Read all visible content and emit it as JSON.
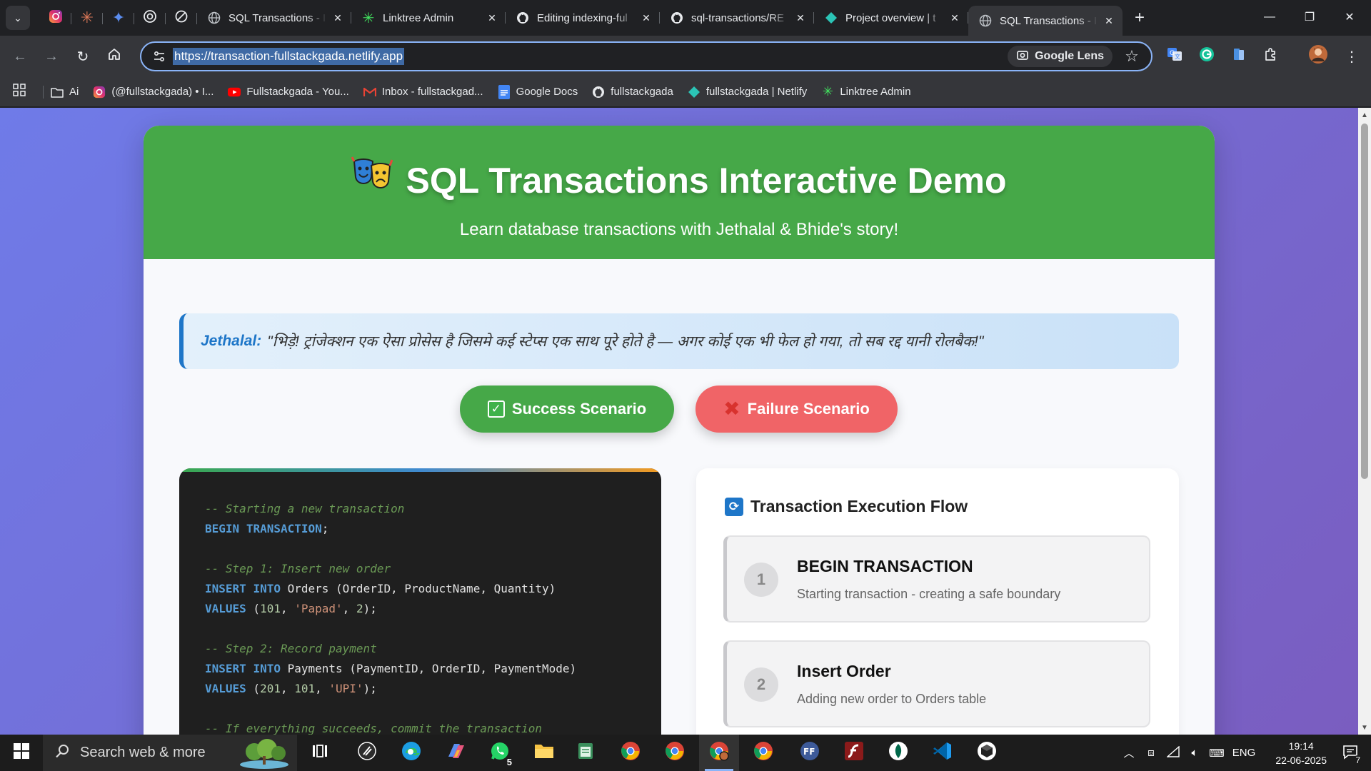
{
  "browser": {
    "pinned_tabs": [
      "instagram-icon",
      "claude-icon",
      "gemini-icon",
      "chatgpt-icon",
      "perplexity-icon"
    ],
    "tabs": [
      {
        "title": "SQL Transactions - I",
        "icon": "globe-icon"
      },
      {
        "title": "Linktree Admin",
        "icon": "linktree-icon"
      },
      {
        "title": "Editing indexing-ful",
        "icon": "github-icon"
      },
      {
        "title": "sql-transactions/RE",
        "icon": "github-icon"
      },
      {
        "title": "Project overview | t",
        "icon": "netlify-icon"
      },
      {
        "title": "SQL Transactions - I",
        "icon": "globe-icon",
        "active": true
      }
    ],
    "url": "https://transaction-fullstackgada.netlify.app",
    "lens_label": "Google Lens",
    "bookmarks": [
      {
        "label": "Ai",
        "icon": "folder-icon"
      },
      {
        "label": "(@fullstackgada) • I...",
        "icon": "instagram-icon"
      },
      {
        "label": "Fullstackgada - You...",
        "icon": "youtube-icon"
      },
      {
        "label": "Inbox - fullstackgad...",
        "icon": "gmail-icon"
      },
      {
        "label": "Google Docs",
        "icon": "docs-icon"
      },
      {
        "label": "fullstackgada",
        "icon": "github-icon"
      },
      {
        "label": "fullstackgada | Netlify",
        "icon": "netlify-icon"
      },
      {
        "label": "Linktree Admin",
        "icon": "linktree-icon"
      }
    ]
  },
  "page": {
    "title": "SQL Transactions Interactive Demo",
    "subtitle": "Learn database transactions with Jethalal & Bhide's story!",
    "quote": {
      "speaker": "Jethalal:",
      "text": "\"भिड़े! ट्रांजेक्शन एक ऐसा प्रोसेस है जिसमे कई स्टेप्स एक साथ पूरे होते है — अगर कोई एक भी फेल हो गया, तो सब रद्द यानी रोलबैक!\""
    },
    "buttons": {
      "success": "Success Scenario",
      "failure": "Failure Scenario"
    },
    "code_lines": [
      [
        {
          "t": "-- Starting a new transaction",
          "c": "cmt"
        }
      ],
      [
        {
          "t": "BEGIN",
          "c": "kw"
        },
        {
          "t": " "
        },
        {
          "t": "TRANSACTION",
          "c": "kw"
        },
        {
          "t": ";"
        }
      ],
      [
        {
          "t": ""
        }
      ],
      [
        {
          "t": "-- Step 1: Insert new order",
          "c": "cmt"
        }
      ],
      [
        {
          "t": "INSERT",
          "c": "kw"
        },
        {
          "t": " "
        },
        {
          "t": "INTO",
          "c": "kw"
        },
        {
          "t": " Orders (OrderID, ProductName, Quantity)"
        }
      ],
      [
        {
          "t": "VALUES",
          "c": "kw"
        },
        {
          "t": " ("
        },
        {
          "t": "101",
          "c": "num"
        },
        {
          "t": ", "
        },
        {
          "t": "'Papad'",
          "c": "str"
        },
        {
          "t": ", "
        },
        {
          "t": "2",
          "c": "num"
        },
        {
          "t": ");"
        }
      ],
      [
        {
          "t": ""
        }
      ],
      [
        {
          "t": "-- Step 2: Record payment",
          "c": "cmt"
        }
      ],
      [
        {
          "t": "INSERT",
          "c": "kw"
        },
        {
          "t": " "
        },
        {
          "t": "INTO",
          "c": "kw"
        },
        {
          "t": " Payments (PaymentID, OrderID, PaymentMode)"
        }
      ],
      [
        {
          "t": "VALUES",
          "c": "kw"
        },
        {
          "t": " ("
        },
        {
          "t": "201",
          "c": "num"
        },
        {
          "t": ", "
        },
        {
          "t": "101",
          "c": "num"
        },
        {
          "t": ", "
        },
        {
          "t": "'UPI'",
          "c": "str"
        },
        {
          "t": ");"
        }
      ],
      [
        {
          "t": ""
        }
      ],
      [
        {
          "t": "-- If everything succeeds, commit the transaction",
          "c": "cmt"
        }
      ]
    ],
    "flow": {
      "title": "Transaction Execution Flow",
      "steps": [
        {
          "num": "1",
          "title": "BEGIN TRANSACTION",
          "desc": "Starting transaction - creating a safe boundary"
        },
        {
          "num": "2",
          "title": "Insert Order",
          "desc": "Adding new order to Orders table"
        }
      ]
    }
  },
  "taskbar": {
    "search_placeholder": "Search web & more",
    "whatsapp_badge": "5",
    "language": "ENG",
    "time": "19:14",
    "date": "22-06-2025",
    "notification_count": "7"
  },
  "colors": {
    "hero_green": "#46a848",
    "failure_red": "#f06467",
    "accent_blue": "#1e76c8",
    "page_gradient_start": "#6f7be8",
    "page_gradient_end": "#7a5dc0"
  }
}
